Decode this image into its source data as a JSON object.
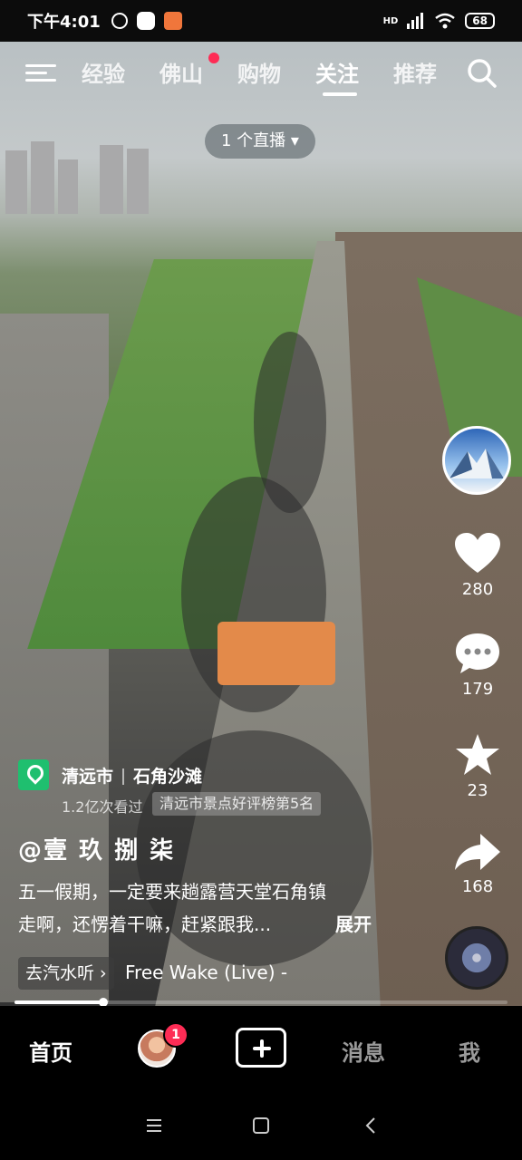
{
  "status_bar": {
    "time": "下午4:01",
    "network": "HD",
    "battery": "68"
  },
  "top_nav": {
    "tabs": [
      {
        "label": "经验",
        "active": false
      },
      {
        "label": "佛山",
        "active": false,
        "has_dot": true
      },
      {
        "label": "购物",
        "active": false
      },
      {
        "label": "关注",
        "active": true
      },
      {
        "label": "推荐",
        "active": false
      }
    ]
  },
  "live_pill": {
    "label": "1 个直播 ▾"
  },
  "right_rail": {
    "like_count": "280",
    "comment_count": "179",
    "favorite_count": "23",
    "share_count": "168"
  },
  "post": {
    "location_city": "清远市",
    "location_place": "石角沙滩",
    "location_views": "1.2亿次看过",
    "location_rank": "清远市景点好评榜第5名",
    "author": "@壹 玖 捌 柒",
    "description_line1": "五一假期，一定要来趟露营天堂石角镇",
    "description_line2": "走啊，还愣着干嘛，赶紧跟我...",
    "expand_label": "展开",
    "music_pill": "去汽水听 ›",
    "music_title": "Free    Wake (Live) -",
    "progress": 0.18
  },
  "tab_bar": {
    "home": "首页",
    "badge": "1",
    "messages": "消息",
    "me": "我"
  },
  "icons": [
    "menu-icon",
    "search-icon",
    "heart-icon",
    "comment-icon",
    "star-icon",
    "share-icon",
    "location-pin-icon",
    "add-icon",
    "back-icon",
    "home-icon",
    "recent-apps-icon"
  ]
}
